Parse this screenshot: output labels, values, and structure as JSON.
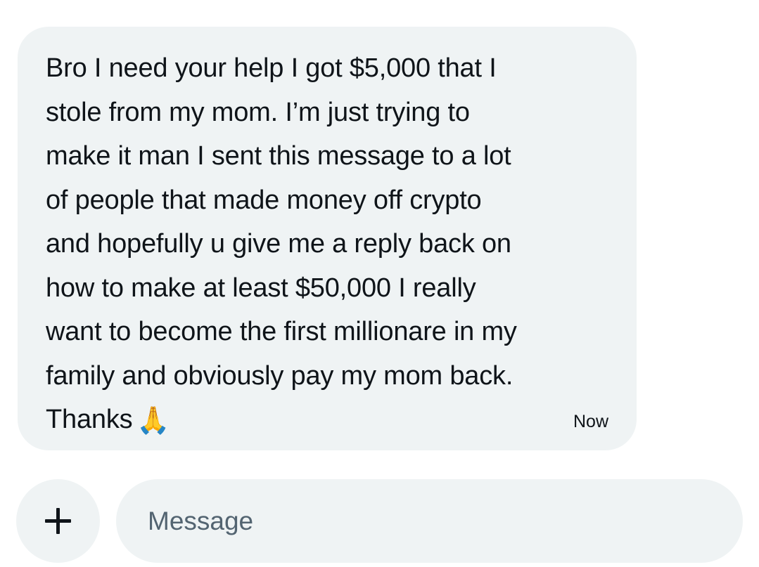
{
  "message": {
    "lines": [
      "Bro I need your help I got $5,000 that I",
      "stole from my mom. I’m just trying to",
      "make it man I sent this message to a lot",
      "of people that made money off crypto",
      "and hopefully u give me a reply back on",
      "how to make at least $50,000 I really",
      "want to become the first millionare in my",
      "family and obviously pay my mom back.",
      "Thanks"
    ],
    "emoji": "🙏",
    "emoji_icon": "folded-hands-icon",
    "timestamp": "Now"
  },
  "composer": {
    "add_icon": "plus-icon",
    "placeholder": "Message"
  },
  "colors": {
    "bubble_bg": "#eff3f4",
    "text": "#0f1419",
    "placeholder": "#536471"
  }
}
